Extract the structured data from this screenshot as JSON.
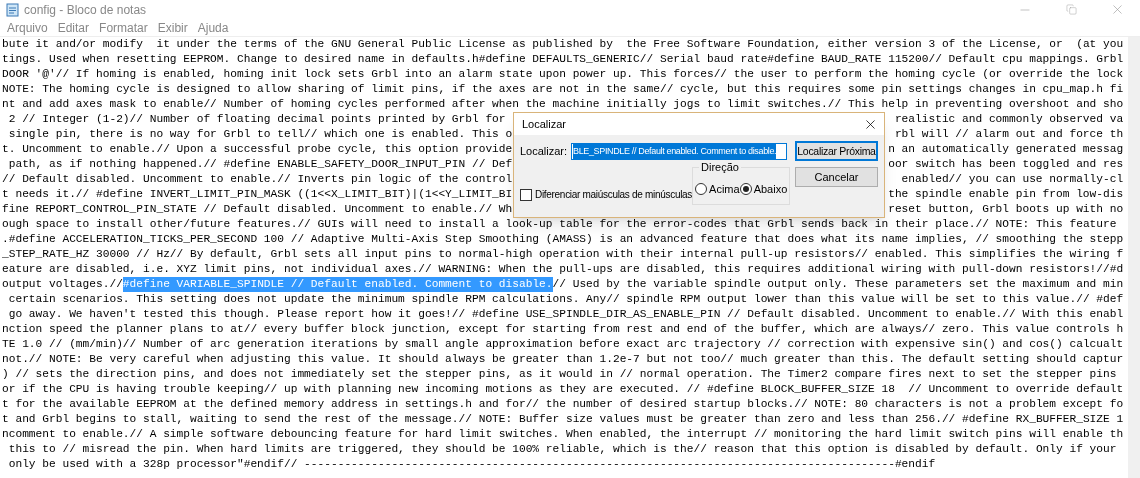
{
  "window": {
    "title": "config - Bloco de notas"
  },
  "menu": [
    "Arquivo",
    "Editar",
    "Formatar",
    "Exibir",
    "Ajuda"
  ],
  "editor": {
    "lines": [
      {
        "kind": "plain",
        "text": "bute it and/or modify  it under the terms of the GNU General Public License as published by  the Free Software Foundation, either version 3 of the License, or  (at you"
      },
      {
        "kind": "plain",
        "text": "tings. Used when resetting EEPROM. Change to desired name in defaults.h#define DEFAULTS_GENERIC// Serial baud rate#define BAUD_RATE 115200// Default cpu mappings. Grbl"
      },
      {
        "kind": "plain",
        "text": "DOOR '@'// If homing is enabled, homing init lock sets Grbl into an alarm state upon power up. This forces// the user to perform the homing cycle (or override the lock"
      },
      {
        "kind": "plain",
        "text": "NOTE: The homing cycle is designed to allow sharing of limit pins, if the axes are not in the same// cycle, but this requires some pin settings changes in cpu_map.h fi"
      },
      {
        "kind": "plain",
        "text": "nt and add axes mask to enable// Number of homing cycles performed after when the machine initially jogs to limit switches.// This help in preventing overshoot and sho"
      },
      {
        "kind": "split",
        "left": " 2 // Integer (1-2)// Number of floating decimal points printed by Grbl for",
        "right": "realistic and commonly observed va"
      },
      {
        "kind": "split",
        "left": " single pin, there is no way for Grbl to tell// which one is enabled. This o",
        "right": "rbl will // alarm out and force th"
      },
      {
        "kind": "split",
        "left": "t. Uncomment to enable.// Upon a successful probe cycle, this option provide",
        "right": "n an automatically generated messag"
      },
      {
        "kind": "split",
        "left": " path, as if nothing happened.// #define ENABLE_SAFETY_DOOR_INPUT_PIN // Def",
        "right": "oor switch has been toggled and res"
      },
      {
        "kind": "split",
        "left": "// Default disabled. Uncomment to enable.// Inverts pin logic of the control",
        "right": "enabled// you can use normally-cl"
      },
      {
        "kind": "split",
        "left": "t needs it.// #define INVERT_LIMIT_PIN_MASK ((1<<X_LIMIT_BIT)|(1<<Y_LIMIT_BI",
        "right": "the spindle enable pin from low-dis"
      },
      {
        "kind": "split",
        "left": "fine REPORT_CONTROL_PIN_STATE // Default disabled. Uncomment to enable.// Wh",
        "right": "reset button, Grbl boots up with no"
      },
      {
        "kind": "plain",
        "text": "ough space to install other/future features.// GUIs will need to install a look-up table for the error-codes that Grbl sends back in their place.// NOTE: This feature"
      },
      {
        "kind": "plain",
        "text": ".#define ACCELERATION_TICKS_PER_SECOND 100 // Adaptive Multi-Axis Step Smoothing (AMASS) is an advanced feature that does what its name implies, // smoothing the stepp"
      },
      {
        "kind": "plain",
        "text": "_STEP_RATE_HZ 30000 // Hz// By default, Grbl sets all input pins to normal-high operation with their internal pull-up resistors// enabled. This simplifies the wiring f"
      },
      {
        "kind": "plain",
        "text": "eature are disabled, i.e. XYZ limit pins, not individual axes.// WARNING: When the pull-ups are disabled, this requires additional wiring with pull-down resistors!//#d"
      },
      {
        "kind": "selection",
        "before": "output voltages.//",
        "selected": "#define VARIABLE_SPINDLE // Default enabled. Comment to disable.",
        "after": "// Used by the variable spindle output only. These parameters set the maximum and min"
      },
      {
        "kind": "plain",
        "text": " certain scenarios. This setting does not update the minimum spindle RPM calculations. Any// spindle RPM output lower than this value will be set to this value.// #def"
      },
      {
        "kind": "plain",
        "text": " go away. We haven't tested this though. Please report how it goes!// #define USE_SPINDLE_DIR_AS_ENABLE_PIN // Default disabled. Uncomment to enable.// With this enabl"
      },
      {
        "kind": "plain",
        "text": "nction speed the planner plans to at// every buffer block junction, except for starting from rest and end of the buffer, which are always// zero. This value controls h"
      },
      {
        "kind": "plain",
        "text": "TE 1.0 // (mm/min)// Number of arc generation iterations by small angle approximation before exact arc trajectory // correction with expensive sin() and cos() calcualt"
      },
      {
        "kind": "plain",
        "text": "not.// NOTE: Be very careful when adjusting this value. It should always be greater than 1.2e-7 but not too// much greater than this. The default setting should captur"
      },
      {
        "kind": "plain",
        "text": ") // sets the direction pins, and does not immediately set the stepper pins, as it would in // normal operation. The Timer2 compare fires next to set the stepper pins"
      },
      {
        "kind": "plain",
        "text": "or if the CPU is having trouble keeping// up with planning new incoming motions as they are executed. // #define BLOCK_BUFFER_SIZE 18  // Uncomment to override default"
      },
      {
        "kind": "plain",
        "text": "t for the available EEPROM at the defined memory address in settings.h and for// the number of desired startup blocks.// NOTE: 80 characters is not a problem except fo"
      },
      {
        "kind": "plain",
        "text": "t and Grbl begins to stall, waiting to send the rest of the message.// NOTE: Buffer size values must be greater than zero and less than 256.// #define RX_BUFFER_SIZE 1"
      },
      {
        "kind": "plain",
        "text": "ncomment to enable.// A simple software debouncing feature for hard limit switches. When enabled, the interrupt // monitoring the hard limit switch pins will enable th"
      },
      {
        "kind": "plain",
        "text": " this to // misread the pin. When hard limits are triggered, they should be 100% reliable, which is the// reason that this option is disabled by default. Only if your"
      },
      {
        "kind": "plain",
        "text": " only be used with a 328p processor\"#endif// ----------------------------------------------------------------------------------------#endif"
      }
    ]
  },
  "find_dialog": {
    "title": "Localizar",
    "label": "Localizar:",
    "value": "BLE_SPINDLE // Default enabled. Comment to disable.",
    "value_selected": true,
    "find_next": "Localizar Próxima",
    "cancel": "Cancelar",
    "match_case": {
      "label": "Diferenciar maiúsculas de minúsculas",
      "checked": false
    },
    "direction": {
      "label": "Direção",
      "options": [
        {
          "label": "Acima",
          "selected": false
        },
        {
          "label": "Abaixo",
          "selected": true
        }
      ]
    }
  }
}
